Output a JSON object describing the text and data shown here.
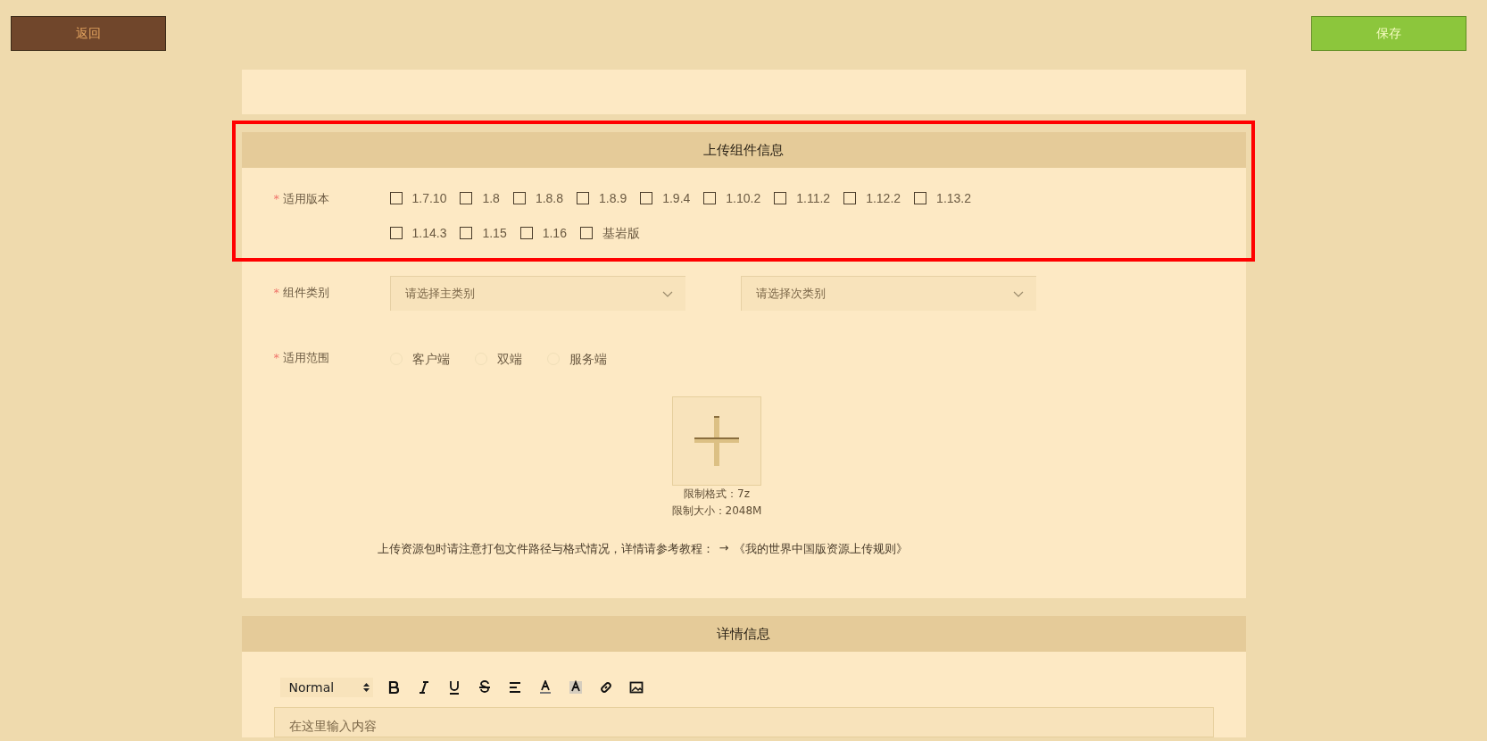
{
  "top_bar": {
    "back_button": "返回",
    "save_button": "保存"
  },
  "upload_section": {
    "title": "上传组件信息",
    "highlighted": true,
    "version_field": {
      "label": "适用版本",
      "required_mark": "*",
      "options": [
        {
          "label": "1.7.10",
          "checked": false
        },
        {
          "label": "1.8",
          "checked": false
        },
        {
          "label": "1.8.8",
          "checked": false
        },
        {
          "label": "1.8.9",
          "checked": false
        },
        {
          "label": "1.9.4",
          "checked": false
        },
        {
          "label": "1.10.2",
          "checked": false
        },
        {
          "label": "1.11.2",
          "checked": false
        },
        {
          "label": "1.12.2",
          "checked": false
        },
        {
          "label": "1.13.2",
          "checked": false
        },
        {
          "label": "1.14.3",
          "checked": false
        },
        {
          "label": "1.15",
          "checked": false
        },
        {
          "label": "1.16",
          "checked": false
        },
        {
          "label": "基岩版",
          "checked": false
        }
      ]
    },
    "category_field": {
      "label": "组件类别",
      "required_mark": "*",
      "selects": [
        {
          "placeholder": "请选择主类别"
        },
        {
          "placeholder": "请选择次类别"
        }
      ]
    },
    "scope_field": {
      "label": "适用范围",
      "required_mark": "*",
      "options": [
        {
          "label": "客户端",
          "selected": false
        },
        {
          "label": "双端",
          "selected": false
        },
        {
          "label": "服务端",
          "selected": false
        }
      ]
    },
    "upload": {
      "format_note": "限制格式：7z",
      "size_note": "限制大小：2048M"
    },
    "notice": {
      "text": "上传资源包时请注意打包文件路径与格式情况，详情请参考教程：",
      "arrow": "→",
      "link": "《我的世界中国版资源上传规则》"
    }
  },
  "details_section": {
    "title": "详情信息",
    "toolbar": {
      "format_select": "Normal"
    },
    "editor": {
      "placeholder": "在这里输入内容"
    }
  }
}
